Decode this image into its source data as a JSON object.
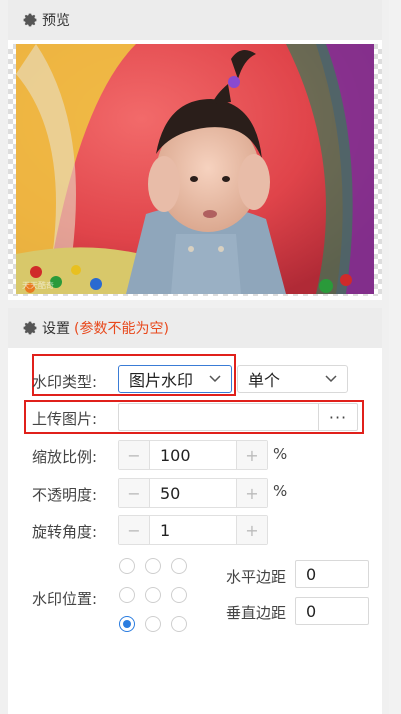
{
  "preview": {
    "title": "预览",
    "watermark_text": "天天酷奇"
  },
  "settings": {
    "title": "设置",
    "warning": "(参数不能为空)",
    "watermark_type": {
      "label": "水印类型:",
      "value": "图片水印",
      "mode": "单个"
    },
    "upload": {
      "label": "上传图片:",
      "value": "",
      "button": "···"
    },
    "scale": {
      "label": "缩放比例:",
      "value": "100",
      "unit": "%"
    },
    "opacity": {
      "label": "不透明度:",
      "value": "50",
      "unit": "%"
    },
    "rotation": {
      "label": "旋转角度:",
      "value": "1"
    },
    "position": {
      "label": "水印位置:",
      "selected": "bottom-left",
      "h_margin_label": "水平边距",
      "h_margin_value": "0",
      "v_margin_label": "垂直边距",
      "v_margin_value": "0"
    }
  },
  "colors": {
    "accent": "#2b7de0",
    "highlight": "#e0201b",
    "warning": "#e8491d"
  }
}
